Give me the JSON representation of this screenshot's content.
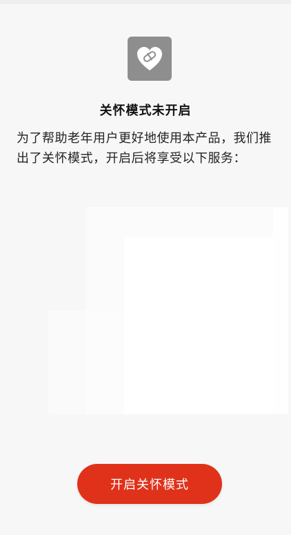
{
  "care_mode": {
    "icon": "heart-pill-icon",
    "title": "关怀模式未开启",
    "description": "为了帮助老年用户更好地使用本产品，我们推出了关怀模式，开启后将享受以下服务："
  },
  "actions": {
    "enable_label": "开启关怀模式"
  },
  "colors": {
    "accent": "#e0321a",
    "icon_tile": "#8e8e8e",
    "background": "#f7f7f7"
  }
}
